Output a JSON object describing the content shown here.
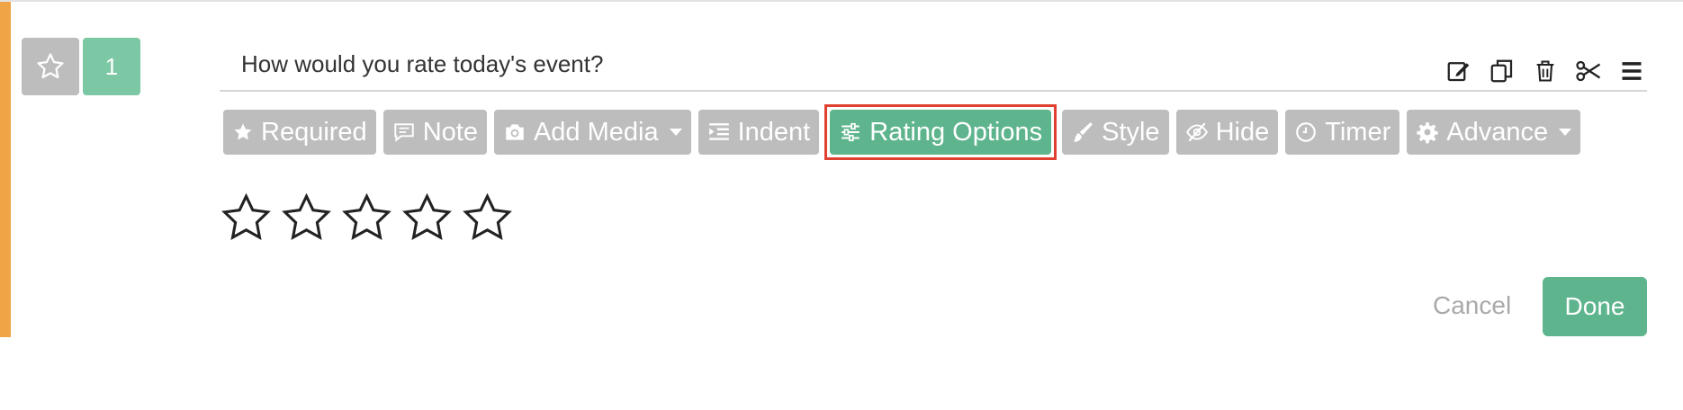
{
  "question": {
    "number": "1",
    "type_icon": "star-outline-icon",
    "text": "How would you rate today's event?",
    "tools": [
      "edit-icon",
      "copy-icon",
      "trash-icon",
      "scissors-icon",
      "menu-icon"
    ]
  },
  "toolbar": {
    "required": "Required",
    "note": "Note",
    "add_media": "Add Media",
    "indent": "Indent",
    "rating_options": "Rating Options",
    "style": "Style",
    "hide": "Hide",
    "timer": "Timer",
    "advance": "Advance"
  },
  "rating": {
    "star_count": 5,
    "selected": 0
  },
  "actions": {
    "cancel": "Cancel",
    "done": "Done"
  },
  "colors": {
    "accent": "#f0a446",
    "active_green": "#5eb58d",
    "badge_green": "#7dc8a4",
    "tool_grey": "#bdbdbd",
    "highlight": "#e0402f"
  }
}
